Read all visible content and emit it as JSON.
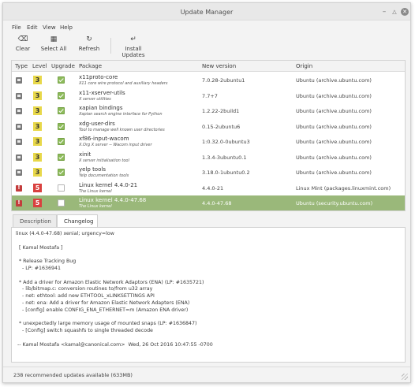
{
  "window": {
    "title": "Update Manager"
  },
  "menu": [
    "File",
    "Edit",
    "View",
    "Help"
  ],
  "toolbar": {
    "clear": "Clear",
    "select_all": "Select All",
    "refresh": "Refresh",
    "install": "Install Updates"
  },
  "table": {
    "headers": {
      "type": "Type",
      "level": "Level",
      "upgrade": "Upgrade",
      "package": "Package",
      "new_version": "New version",
      "origin": "Origin"
    },
    "rows": [
      {
        "type": "package",
        "level": "3",
        "checked": true,
        "name": "x11proto-core",
        "desc": "X11 core wire protocol and auxiliary headers",
        "version": "7.0.28-2ubuntu1",
        "origin": "Ubuntu (archive.ubuntu.com)"
      },
      {
        "type": "package",
        "level": "3",
        "checked": true,
        "name": "x11-xserver-utils",
        "desc": "X server utilities",
        "version": "7.7+7",
        "origin": "Ubuntu (archive.ubuntu.com)"
      },
      {
        "type": "package",
        "level": "3",
        "checked": true,
        "name": "xapian bindings",
        "desc": "Xapian search engine interface for Python",
        "version": "1.2.22-2build1",
        "origin": "Ubuntu (archive.ubuntu.com)"
      },
      {
        "type": "package",
        "level": "3",
        "checked": true,
        "name": "xdg-user-dirs",
        "desc": "Tool to manage well known user directories",
        "version": "0.15-2ubuntu6",
        "origin": "Ubuntu (archive.ubuntu.com)"
      },
      {
        "type": "package",
        "level": "3",
        "checked": true,
        "name": "xf86-input-wacom",
        "desc": "X.Org X server -- Wacom input driver",
        "version": "1:0.32.0-0ubuntu3",
        "origin": "Ubuntu (archive.ubuntu.com)"
      },
      {
        "type": "package",
        "level": "3",
        "checked": true,
        "name": "xinit",
        "desc": "X server initialisation tool",
        "version": "1.3.4-3ubuntu0.1",
        "origin": "Ubuntu (archive.ubuntu.com)"
      },
      {
        "type": "package",
        "level": "3",
        "checked": true,
        "name": "yelp tools",
        "desc": "Yelp documentation tools",
        "version": "3.18.0-1ubuntu0.2",
        "origin": "Ubuntu (archive.ubuntu.com)"
      },
      {
        "type": "kernel",
        "level": "5",
        "checked": false,
        "name": "Linux kernel 4.4.0-21",
        "desc": "The Linux kernel",
        "version": "4.4.0-21",
        "origin": "Linux Mint (packages.linuxmint.com)"
      },
      {
        "type": "kernel",
        "level": "5",
        "checked": false,
        "selected": true,
        "name": "Linux kernel 4.4.0-47.68",
        "desc": "The Linux kernel",
        "version": "4.4.0-47.68",
        "origin": "Ubuntu (security.ubuntu.com)"
      }
    ]
  },
  "tabs": {
    "description": "Description",
    "changelog": "Changelog"
  },
  "changelog": [
    "linux (4.4.0-47.68) xenial; urgency=low",
    "",
    "  [ Kamal Mostafa ]",
    "",
    "  * Release Tracking Bug",
    "    - LP: #1636941",
    "",
    "  * Add a driver for Amazon Elastic Network Adaptors (ENA) (LP: #1635721)",
    "    - lib/bitmap.c: conversion routines to/from u32 array",
    "    - net: ethtool: add new ETHTOOL_xLINKSETTINGS API",
    "    - net: ena: Add a driver for Amazon Elastic Network Adapters (ENA)",
    "    - [config] enable CONFIG_ENA_ETHERNET=m (Amazon ENA driver)",
    "",
    "  * unexpectedly large memory usage of mounted snaps (LP: #1636847)",
    "    - [Config] switch squashfs to single threaded decode",
    "",
    " -- Kamal Mostafa <kamal@canonical.com>  Wed, 26 Oct 2016 10:47:55 -0700"
  ],
  "status": "238 recommended updates available (633MB)",
  "colors": {
    "selection": "#9ab87a",
    "level3": "#e8d84a",
    "level5": "#d9413f",
    "checkbox": "#8dbb5a"
  }
}
